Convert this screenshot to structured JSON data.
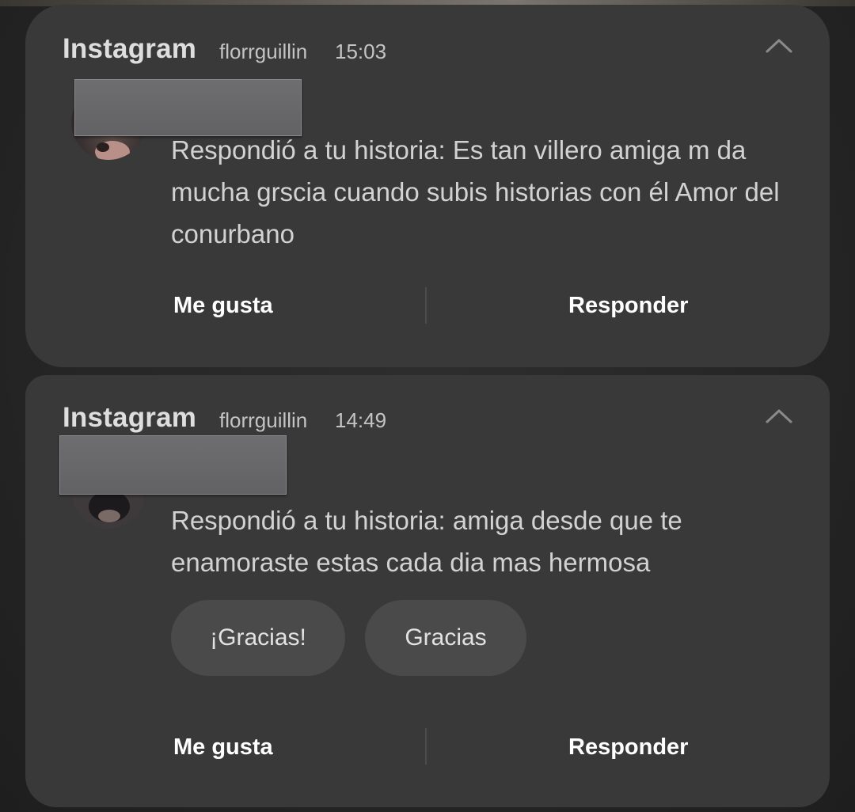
{
  "notifications": [
    {
      "app_name": "Instagram",
      "username": "florrguillin",
      "time": "15:03",
      "message": "Respondió a tu historia: Es tan villero amiga m da mucha grscia cuando subis historias con él Amor del conurbano",
      "actions": {
        "like": "Me gusta",
        "reply": "Responder"
      },
      "collapse_icon": "chevron-up-icon"
    },
    {
      "app_name": "Instagram",
      "username": "florrguillin",
      "time": "14:49",
      "message": "Respondió a tu historia: amiga desde que te enamoraste estas cada dia mas hermosa",
      "smart_replies": [
        "¡Gracias!",
        "Gracias"
      ],
      "actions": {
        "like": "Me gusta",
        "reply": "Responder"
      },
      "collapse_icon": "chevron-up-icon"
    }
  ],
  "colors": {
    "card_background": "#393939",
    "primary_text": "#d2d2d2",
    "action_text": "#ffffff",
    "chip_background": "#4a4a4a"
  }
}
